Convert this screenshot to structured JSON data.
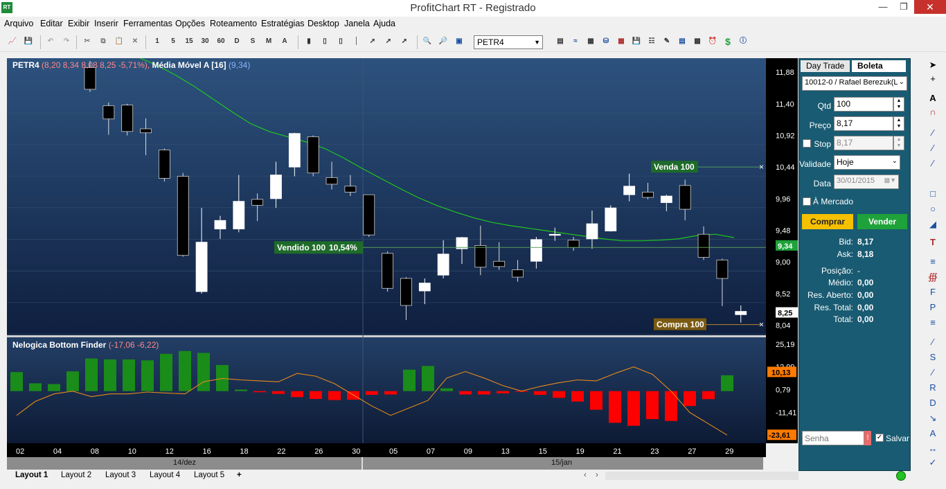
{
  "window": {
    "title": "ProfitChart RT - Registrado",
    "app_icon": "RT"
  },
  "menu": [
    "Arquivo",
    "Editar",
    "Exibir",
    "Inserir",
    "Ferramentas",
    "Opções",
    "Roteamento",
    "Estratégias",
    "Desktop",
    "Janela",
    "Ajuda"
  ],
  "toolbar": {
    "ticker": "PETR4",
    "period_buttons": [
      "1",
      "5",
      "15",
      "30",
      "60",
      "D",
      "S",
      "M",
      "A"
    ]
  },
  "chart_data": [
    {
      "type": "candlestick",
      "title": "PETR4",
      "header_quote": "(8,20  8,34  8,08  8,25  -5,71%),",
      "overlay_name": "Média Móvel A [16]",
      "overlay_value": "(9,34)",
      "yticks": [
        "11,88",
        "11,40",
        "10,92",
        "10,44",
        "9,96",
        "9,48",
        "9,00",
        "8,52",
        "8,04"
      ],
      "ylim": [
        7.93,
        12.05
      ],
      "last_price": "8,25",
      "ma_value_badge": "9,34",
      "xticks": [
        "02",
        "04",
        "08",
        "10",
        "12",
        "16",
        "18",
        "22",
        "26",
        "30",
        "05",
        "07",
        "09",
        "13",
        "15",
        "19",
        "21",
        "23",
        "27",
        "29"
      ],
      "period_labels": [
        "14/dez",
        "15/jan"
      ],
      "candles": [
        {
          "o": 11.95,
          "h": 12.05,
          "l": 11.58,
          "c": 11.62
        },
        {
          "o": 11.37,
          "h": 11.42,
          "l": 10.93,
          "c": 11.17
        },
        {
          "o": 11.38,
          "h": 11.4,
          "l": 10.92,
          "c": 10.98
        },
        {
          "o": 11.02,
          "h": 11.18,
          "l": 10.62,
          "c": 10.96
        },
        {
          "o": 10.7,
          "h": 10.72,
          "l": 10.22,
          "c": 10.27
        },
        {
          "o": 10.3,
          "h": 10.35,
          "l": 9.08,
          "c": 9.1
        },
        {
          "o": 8.55,
          "h": 9.82,
          "l": 8.52,
          "c": 9.3
        },
        {
          "o": 9.5,
          "h": 9.7,
          "l": 9.35,
          "c": 9.63
        },
        {
          "o": 9.5,
          "h": 10.32,
          "l": 9.45,
          "c": 9.92
        },
        {
          "o": 9.95,
          "h": 10.04,
          "l": 9.62,
          "c": 9.86
        },
        {
          "o": 9.96,
          "h": 10.52,
          "l": 9.82,
          "c": 10.32
        },
        {
          "o": 10.44,
          "h": 10.96,
          "l": 10.3,
          "c": 10.95
        },
        {
          "o": 10.9,
          "h": 10.92,
          "l": 10.3,
          "c": 10.35
        },
        {
          "o": 10.28,
          "h": 10.52,
          "l": 10.1,
          "c": 10.18
        },
        {
          "o": 10.15,
          "h": 10.32,
          "l": 10.0,
          "c": 10.06
        },
        {
          "o": 10.02,
          "h": 10.02,
          "l": 9.38,
          "c": 9.41
        },
        {
          "o": 9.13,
          "h": 9.16,
          "l": 8.55,
          "c": 8.6
        },
        {
          "o": 8.75,
          "h": 8.77,
          "l": 8.12,
          "c": 8.34
        },
        {
          "o": 8.56,
          "h": 8.75,
          "l": 8.36,
          "c": 8.68
        },
        {
          "o": 8.8,
          "h": 9.33,
          "l": 8.75,
          "c": 9.12
        },
        {
          "o": 9.2,
          "h": 9.38,
          "l": 8.97,
          "c": 9.37
        },
        {
          "o": 9.25,
          "h": 9.55,
          "l": 8.8,
          "c": 8.92
        },
        {
          "o": 9.01,
          "h": 9.3,
          "l": 8.88,
          "c": 8.93
        },
        {
          "o": 8.88,
          "h": 9.03,
          "l": 8.7,
          "c": 8.77
        },
        {
          "o": 9.01,
          "h": 9.38,
          "l": 8.9,
          "c": 9.34
        },
        {
          "o": 9.42,
          "h": 9.52,
          "l": 9.32,
          "c": 9.42
        },
        {
          "o": 9.33,
          "h": 9.38,
          "l": 9.17,
          "c": 9.22
        },
        {
          "o": 9.35,
          "h": 9.78,
          "l": 9.2,
          "c": 9.58
        },
        {
          "o": 9.47,
          "h": 9.86,
          "l": 9.46,
          "c": 9.82
        },
        {
          "o": 10.02,
          "h": 10.34,
          "l": 9.92,
          "c": 10.15
        },
        {
          "o": 10.06,
          "h": 10.2,
          "l": 9.95,
          "c": 9.98
        },
        {
          "o": 9.9,
          "h": 10.02,
          "l": 9.77,
          "c": 10.0
        },
        {
          "o": 10.16,
          "h": 10.25,
          "l": 9.63,
          "c": 9.8
        },
        {
          "o": 9.42,
          "h": 9.54,
          "l": 9.03,
          "c": 9.07
        },
        {
          "o": 9.03,
          "h": 9.05,
          "l": 8.33,
          "c": 8.75
        },
        {
          "o": 8.2,
          "h": 8.34,
          "l": 8.08,
          "c": 8.25
        }
      ],
      "moving_average": [
        12.35,
        12.27,
        12.19,
        12.1,
        11.98,
        11.83,
        11.66,
        11.47,
        11.28,
        11.1,
        10.98,
        10.9,
        10.82,
        10.72,
        10.58,
        10.42,
        10.27,
        10.12,
        9.98,
        9.86,
        9.76,
        9.67,
        9.6,
        9.55,
        9.51,
        9.47,
        9.43,
        9.39,
        9.35,
        9.32,
        9.32,
        9.33,
        9.35,
        9.4,
        9.42,
        9.37
      ],
      "order_lines": [
        {
          "label": "Venda 100",
          "price": 10.44,
          "color": "#1e6b2a",
          "line": "#4c9a5a"
        },
        {
          "label": "Compra 100",
          "price": 8.05,
          "color": "#7a5a12",
          "line": "#b8862a"
        }
      ],
      "position_line": {
        "label": "Vendido 100",
        "pnl": "10,54%",
        "price": 9.22
      }
    },
    {
      "type": "bar",
      "title": "Nelogica Bottom Finder",
      "header_values": "(-17,06  -6,22)",
      "yticks": [
        "25,19",
        "12,99",
        "0,79",
        "-11,41"
      ],
      "ylim": [
        -26.5,
        27.0
      ],
      "badges": [
        "10,13",
        "-23,61"
      ],
      "bars": [
        10.2,
        4.2,
        3.8,
        10.6,
        17.5,
        17.0,
        17.0,
        16.5,
        20.0,
        21.5,
        20.5,
        14.0,
        0.8,
        -0.6,
        -1.5,
        -3.2,
        -4.2,
        -4.8,
        -4.6,
        -2.0,
        -1.8,
        11.5,
        13.5,
        1.5,
        -1.8,
        -1.8,
        -1.2,
        -0.4,
        -2.0,
        -3.6,
        -5.6,
        -10.0,
        -17.0,
        -18.6,
        -15.0,
        -16.0,
        -8.0,
        -4.3,
        8.5
      ],
      "signal": [
        -13.0,
        -5.5,
        -1.5,
        0.0,
        -3.0,
        -1.5,
        -1.5,
        -0.5,
        -1.0,
        -1.5,
        5.0,
        6.8,
        6.0,
        5.5,
        5.0,
        9.5,
        8.0,
        4.0,
        -2.0,
        -8.0,
        -13.0,
        -9.0,
        -5.0,
        7.0,
        10.5,
        7.0,
        3.0,
        0.0,
        2.5,
        4.5,
        6.0,
        5.5,
        9.5,
        13.0,
        9.0,
        0.0,
        -11.5,
        -17.5,
        -23.6
      ]
    }
  ],
  "sidepanel": {
    "tabs": [
      "Day Trade",
      "Boleta"
    ],
    "account": "10012-0 / Rafael Berezuk(L",
    "qtd_label": "Qtd",
    "qtd": "100",
    "preco_label": "Preço",
    "preco": "8,17",
    "stop_label": "Stop",
    "stop": "8,17",
    "validade_label": "Validade",
    "validade": "Hoje",
    "data_label": "Data",
    "data": "30/01/2015",
    "mercado_label": "À Mercado",
    "buy": "Comprar",
    "sell": "Vender",
    "bid_label": "Bid:",
    "bid": "8,17",
    "ask_label": "Ask:",
    "ask": "8,18",
    "posicao_label": "Posição:",
    "posicao": "-",
    "medio_label": "Médio:",
    "medio": "0,00",
    "res_aberto_label": "Res. Aberto:",
    "res_aberto": "0,00",
    "res_total_label": "Res. Total:",
    "res_total": "0,00",
    "total_label": "Total:",
    "total": "0,00",
    "senha_placeholder": "Senha",
    "salvar_label": "Salvar"
  },
  "layout_tabs": [
    "Layout 1",
    "Layout 2",
    "Layout 3",
    "Layout 4",
    "Layout 5",
    "+"
  ],
  "colors": {
    "up": "#ffffff",
    "down": "#000000",
    "ma": "#1ec81e",
    "pos_bar": "#1a8c1a",
    "neg_bar": "#ff0000",
    "signal": "#e88a1a",
    "panel": "#195b72"
  }
}
